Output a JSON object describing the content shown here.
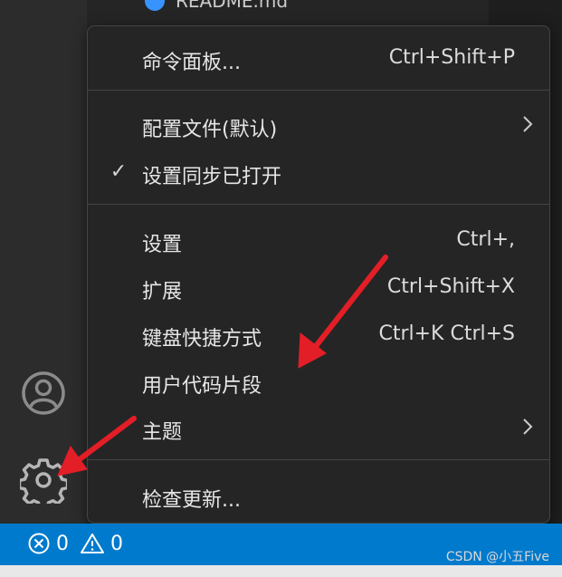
{
  "explorer": {
    "file_name": "README.md"
  },
  "activity_bar": {
    "accounts_icon": "account-icon",
    "manage_icon": "gear-icon"
  },
  "menu": {
    "items": [
      {
        "label": "命令面板...",
        "shortcut": "Ctrl+Shift+P"
      },
      {
        "label": "配置文件(默认)",
        "has_submenu": true
      },
      {
        "label": "设置同步已打开",
        "checked": true
      },
      {
        "label": "设置",
        "shortcut": "Ctrl+,"
      },
      {
        "label": "扩展",
        "shortcut": "Ctrl+Shift+X"
      },
      {
        "label": "键盘快捷方式",
        "shortcut": "Ctrl+K Ctrl+S"
      },
      {
        "label": "用户代码片段"
      },
      {
        "label": "主题",
        "has_submenu": true
      },
      {
        "label": "检查更新..."
      }
    ]
  },
  "status_bar": {
    "errors": "0",
    "warnings": "0"
  },
  "watermark": "CSDN @小五Five",
  "colors": {
    "status_bar": "#007acc",
    "annotation_arrow": "#e41e26",
    "menu_bg": "#252526"
  }
}
